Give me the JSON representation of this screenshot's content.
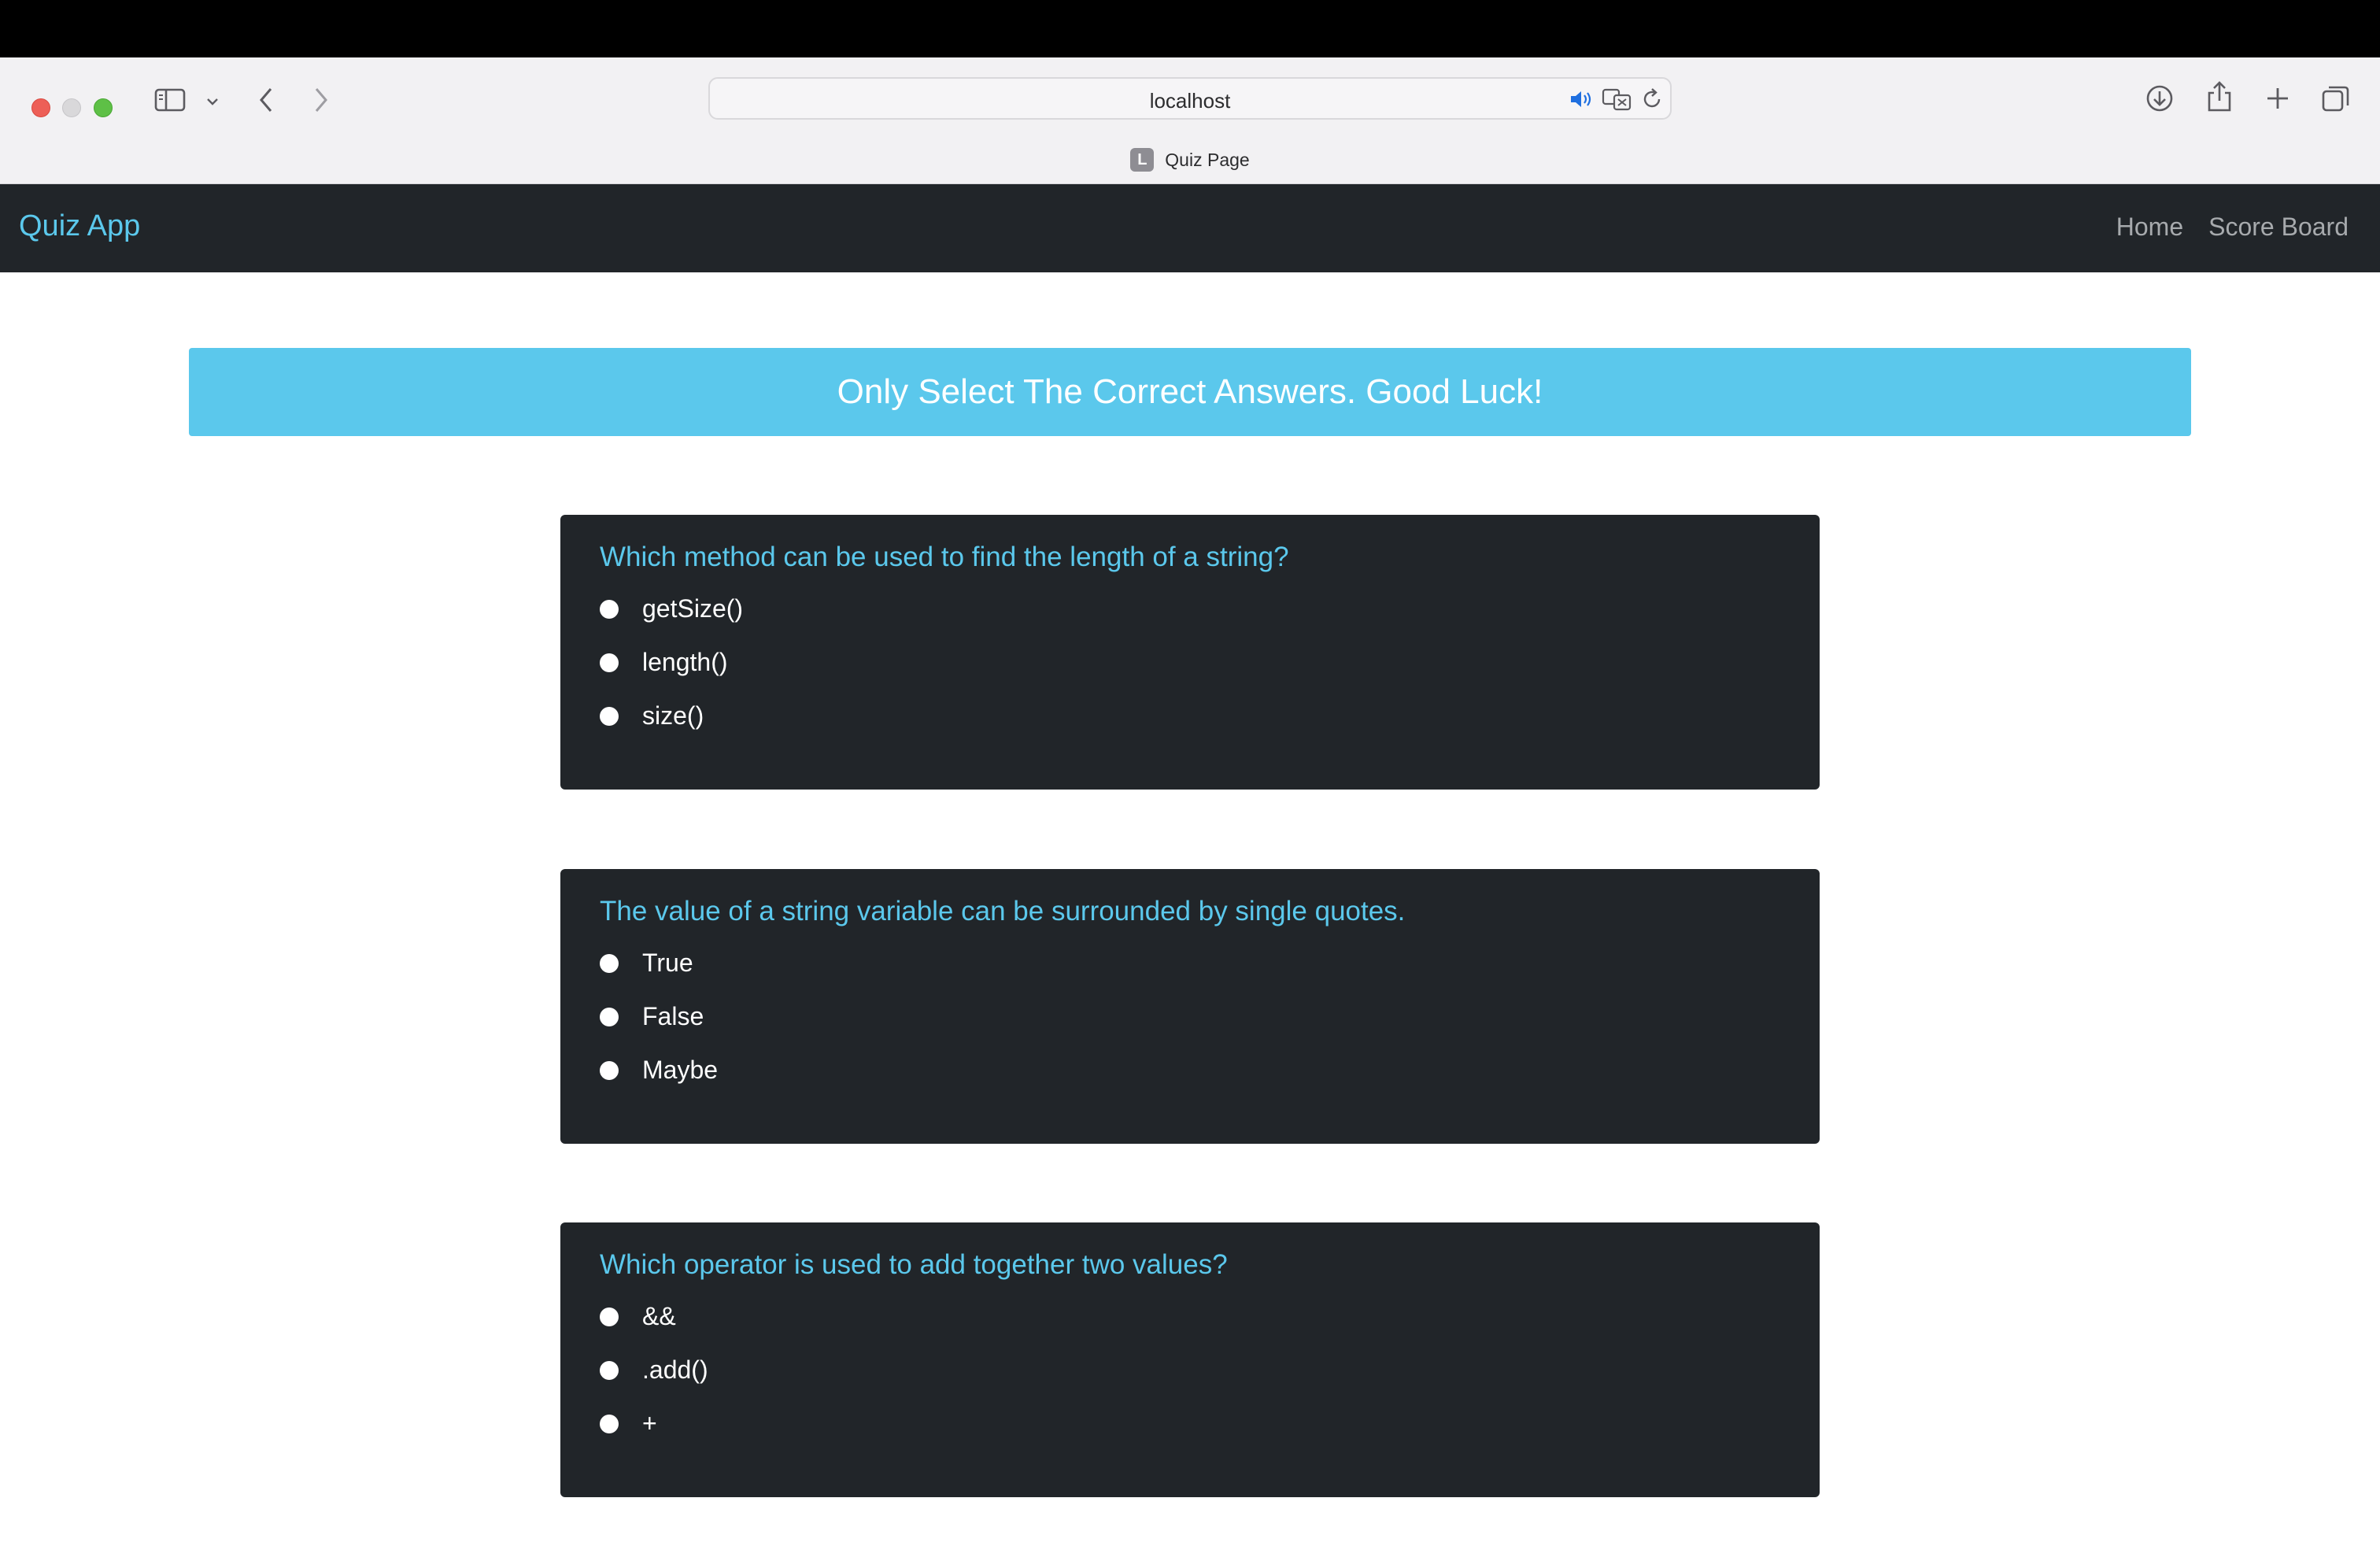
{
  "browser": {
    "url": "localhost",
    "tab_title": "Quiz Page",
    "tab_favicon_letter": "L"
  },
  "navbar": {
    "brand": "Quiz App",
    "links": [
      "Home",
      "Score Board"
    ]
  },
  "banner": {
    "text": "Only Select The Correct Answers. Good Luck!"
  },
  "questions": [
    {
      "text": "Which method can be used to find the length of a string?",
      "options": [
        "getSize()",
        "length()",
        "size()"
      ]
    },
    {
      "text": "The value of a string variable can be surrounded by single quotes.",
      "options": [
        "True",
        "False",
        "Maybe"
      ]
    },
    {
      "text": "Which operator is used to add together two values?",
      "options": [
        "&&",
        ".add()",
        "+"
      ]
    }
  ],
  "colors": {
    "accent": "#5bc8ec",
    "dark": "#212529",
    "chrome": "#f2f1f3"
  }
}
